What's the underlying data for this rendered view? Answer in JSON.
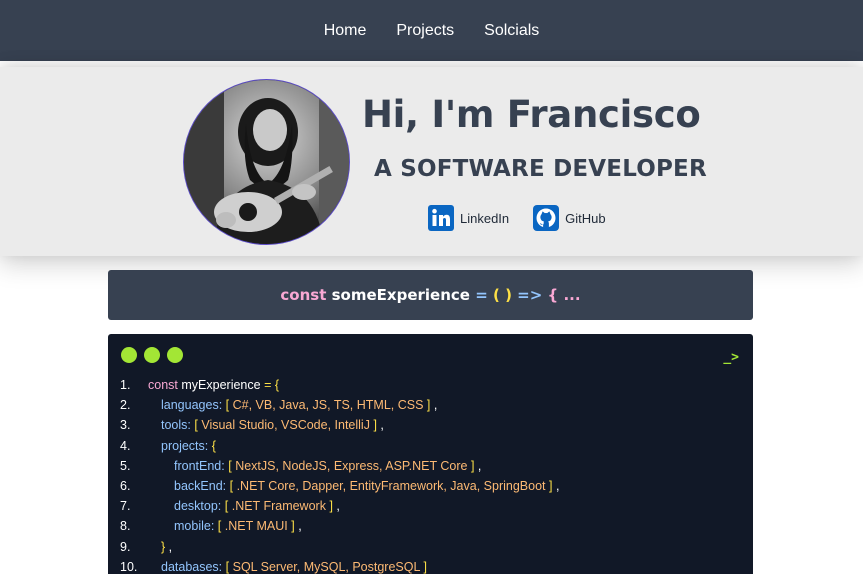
{
  "nav": {
    "home": "Home",
    "projects": "Projects",
    "socials": "Solcials"
  },
  "hero": {
    "title": "Hi, I'm Francisco",
    "subtitle": "A SOFTWARE DEVELOPER",
    "linkedin": "LinkedIn",
    "github": "GitHub"
  },
  "banner": {
    "keyword": "const",
    "name": "someExperience",
    "equals": "=",
    "parens": "( )",
    "arrow": "=>",
    "brace": "{",
    "ellipsis": "..."
  },
  "editor": {
    "prompt": "_>",
    "lines": [
      {
        "num": "1.",
        "indent": 0,
        "pre": "const",
        "var": "myExperience",
        "key": "",
        "open": "= {",
        "value": "",
        "close": "",
        "end": ""
      },
      {
        "num": "2.",
        "indent": 1,
        "pre": "",
        "var": "",
        "key": "languages:",
        "open": "[",
        "value": "C#, VB, Java, JS, TS, HTML, CSS",
        "close": "]",
        "end": ","
      },
      {
        "num": "3.",
        "indent": 1,
        "pre": "",
        "var": "",
        "key": "tools:",
        "open": "[",
        "value": "Visual Studio, VSCode, IntelliJ",
        "close": "]",
        "end": ","
      },
      {
        "num": "4.",
        "indent": 1,
        "pre": "",
        "var": "",
        "key": "projects:",
        "open": "{",
        "value": "",
        "close": "",
        "end": ""
      },
      {
        "num": "5.",
        "indent": 2,
        "pre": "",
        "var": "",
        "key": "frontEnd:",
        "open": "[",
        "value": "NextJS, NodeJS, Express, ASP.NET Core",
        "close": "]",
        "end": ","
      },
      {
        "num": "6.",
        "indent": 2,
        "pre": "",
        "var": "",
        "key": "backEnd:",
        "open": "[",
        "value": ".NET Core, Dapper, EntityFramework, Java, SpringBoot",
        "close": "]",
        "end": ","
      },
      {
        "num": "7.",
        "indent": 2,
        "pre": "",
        "var": "",
        "key": "desktop:",
        "open": "[",
        "value": ".NET Framework",
        "close": "]",
        "end": ","
      },
      {
        "num": "8.",
        "indent": 2,
        "pre": "",
        "var": "",
        "key": "mobile:",
        "open": "[",
        "value": ".NET MAUI",
        "close": "]",
        "end": ","
      },
      {
        "num": "9.",
        "indent": 1,
        "pre": "",
        "var": "",
        "key": "",
        "open": "}",
        "value": "",
        "close": "",
        "end": ","
      },
      {
        "num": "10.",
        "indent": 1,
        "pre": "",
        "var": "",
        "key": "databases:",
        "open": "[",
        "value": "SQL Server, MySQL, PostgreSQL",
        "close": "]",
        "end": ""
      }
    ]
  },
  "colors": {
    "nav_bg": "#374151",
    "hero_bg": "#ebebeb",
    "editor_bg": "#111827",
    "dot": "#a3e635",
    "keyword": "#f9a8d4",
    "key": "#93c5fd",
    "bracket": "#fde047",
    "value": "#fdba74",
    "linkedin": "#0a66c2"
  }
}
